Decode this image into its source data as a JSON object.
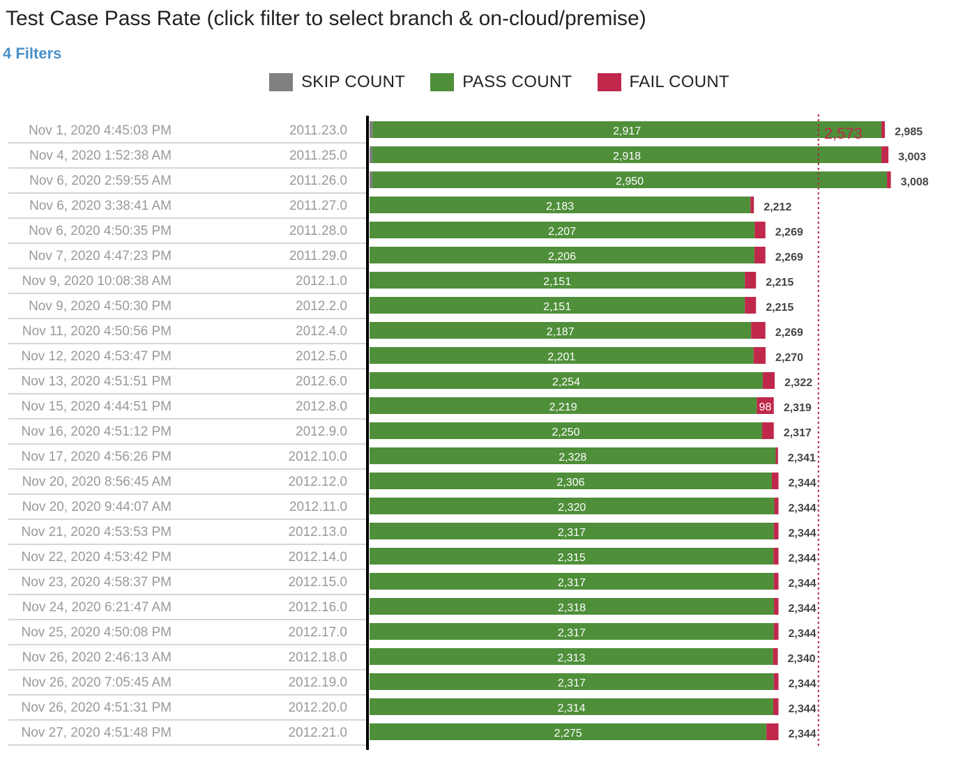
{
  "title": "Test Case Pass Rate  (click filter to select branch & on-cloud/premise)",
  "filters_label": "4 Filters",
  "colors": {
    "skip": "#808080",
    "pass": "#4f8f3a",
    "fail": "#c0284b",
    "reference": "#b22046"
  },
  "chart_data": {
    "type": "bar",
    "orientation": "horizontal",
    "stacked": true,
    "legend": [
      "SKIP COUNT",
      "PASS COUNT",
      "FAIL COUNT"
    ],
    "legend_position": "top",
    "categories": [
      {
        "date": "Nov 1, 2020 4:45:03 PM",
        "build": "2011.23.0"
      },
      {
        "date": "Nov 4, 2020 1:52:38 AM",
        "build": "2011.25.0"
      },
      {
        "date": "Nov 6, 2020 2:59:55 AM",
        "build": "2011.26.0"
      },
      {
        "date": "Nov 6, 2020 3:38:41 AM",
        "build": "2011.27.0"
      },
      {
        "date": "Nov 6, 2020 4:50:35 PM",
        "build": "2011.28.0"
      },
      {
        "date": "Nov 7, 2020 4:47:23 PM",
        "build": "2011.29.0"
      },
      {
        "date": "Nov 9, 2020 10:08:38 AM",
        "build": "2012.1.0"
      },
      {
        "date": "Nov 9, 2020 4:50:30 PM",
        "build": "2012.2.0"
      },
      {
        "date": "Nov 11, 2020 4:50:56 PM",
        "build": "2012.4.0"
      },
      {
        "date": "Nov 12, 2020 4:53:47 PM",
        "build": "2012.5.0"
      },
      {
        "date": "Nov 13, 2020 4:51:51 PM",
        "build": "2012.6.0"
      },
      {
        "date": "Nov 15, 2020 4:44:51 PM",
        "build": "2012.8.0"
      },
      {
        "date": "Nov 16, 2020 4:51:12 PM",
        "build": "2012.9.0"
      },
      {
        "date": "Nov 17, 2020 4:56:26 PM",
        "build": "2012.10.0"
      },
      {
        "date": "Nov 20, 2020 8:56:45 AM",
        "build": "2012.12.0"
      },
      {
        "date": "Nov 20, 2020 9:44:07 AM",
        "build": "2012.11.0"
      },
      {
        "date": "Nov 21, 2020 4:53:53 PM",
        "build": "2012.13.0"
      },
      {
        "date": "Nov 22, 2020 4:53:42 PM",
        "build": "2012.14.0"
      },
      {
        "date": "Nov 23, 2020 4:58:37 PM",
        "build": "2012.15.0"
      },
      {
        "date": "Nov 24, 2020 6:21:47 AM",
        "build": "2012.16.0"
      },
      {
        "date": "Nov 25, 2020 4:50:08 PM",
        "build": "2012.17.0"
      },
      {
        "date": "Nov 26, 2020 2:46:13 AM",
        "build": "2012.18.0"
      },
      {
        "date": "Nov 26, 2020 7:05:45 AM",
        "build": "2012.19.0"
      },
      {
        "date": "Nov 26, 2020 4:51:31 PM",
        "build": "2012.20.0"
      },
      {
        "date": "Nov 27, 2020 4:51:48 PM",
        "build": "2012.21.0"
      }
    ],
    "series": [
      {
        "name": "SKIP COUNT",
        "values": [
          17,
          16,
          16,
          0,
          0,
          0,
          0,
          0,
          0,
          0,
          0,
          0,
          0,
          0,
          0,
          0,
          0,
          0,
          0,
          0,
          0,
          0,
          0,
          0,
          0
        ]
      },
      {
        "name": "PASS COUNT",
        "values": [
          2917,
          2918,
          2950,
          2183,
          2207,
          2206,
          2151,
          2151,
          2187,
          2201,
          2254,
          2219,
          2250,
          2328,
          2306,
          2320,
          2317,
          2315,
          2317,
          2318,
          2317,
          2313,
          2317,
          2314,
          2275
        ]
      },
      {
        "name": "FAIL COUNT",
        "values": [
          20,
          40,
          22,
          20,
          62,
          63,
          64,
          64,
          82,
          69,
          68,
          98,
          67,
          13,
          38,
          24,
          27,
          29,
          27,
          26,
          27,
          27,
          27,
          30,
          69
        ]
      }
    ],
    "totals": [
      2985,
      3003,
      3008,
      2212,
      2269,
      2269,
      2215,
      2215,
      2269,
      2270,
      2322,
      2319,
      2317,
      2341,
      2344,
      2344,
      2344,
      2344,
      2344,
      2344,
      2344,
      2340,
      2344,
      2344,
      2344
    ],
    "reference_line": {
      "value": 2573,
      "label": "2,573",
      "style": "dotted"
    },
    "xlim": [
      0,
      3300
    ],
    "grid": false
  }
}
